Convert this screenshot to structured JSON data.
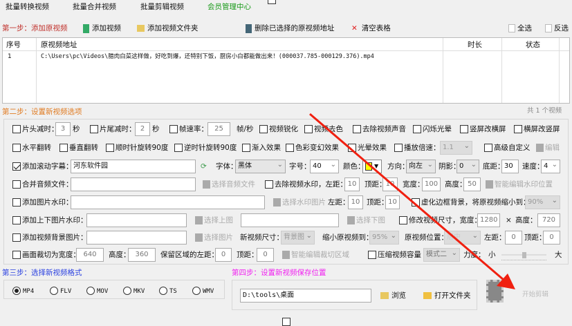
{
  "tabs": [
    "批量转换视频",
    "批量合并视频",
    "批量剪辑视频",
    "会员管理中心"
  ],
  "step1": {
    "title": "第一步：添加原视频",
    "add_video": "添加视频",
    "add_folder": "添加视频文件夹",
    "delete_selected": "删除已选择的原视频地址",
    "clear_table": "清空表格",
    "select_all": "全选",
    "invert": "反选"
  },
  "table": {
    "headers": [
      "序号",
      "原视频地址",
      "时长",
      "状态"
    ],
    "rows": [
      {
        "index": "1",
        "path": "C:\\Users\\pc\\Videos\\腊肉白菜这样做，好吃到爆，还特别下饭，厨房小白都能做出来！(000037.785-000129.376).mp4"
      }
    ]
  },
  "step2": {
    "title": "第二步：设置新视频选项",
    "count": "共 1 个视频",
    "head_trim": "片头减时：",
    "head_val": "3",
    "sec": "秒",
    "tail_trim": "片尾减时：",
    "tail_val": "2",
    "fps": "帧速率：",
    "fps_val": "25",
    "fps_unit": "帧/秒",
    "sharpen": "视频锐化",
    "decolor": "视频去色",
    "mute": "去除视频声音",
    "flash": "闪烁光晕",
    "v2h": "竖屏改横屏",
    "h2v": "横屏改竖屏",
    "hflip": "水平翻转",
    "vflip": "垂直翻转",
    "cw90": "顺时针旋转90度",
    "ccw90": "逆时针旋转90度",
    "fadein": "渐入效果",
    "color_fx": "色彩变幻效果",
    "halo": "光晕效果",
    "speed": "播放倍速：",
    "speed_val": "1.1",
    "advanced": "高级自定义",
    "edit": "编辑",
    "subtitle": "添加滚动字幕：",
    "subtitle_val": "河东软件园",
    "font": "字体：",
    "font_val": "黑体(simhei)",
    "size": "字号：",
    "size_val": "40",
    "color": "颜色：",
    "color_val": "#ffff00",
    "dir": "方向：",
    "dir_val": "向左",
    "shadow": "阴影：",
    "shadow_val": "0",
    "bottom": "底距：",
    "bottom_val": "30",
    "rate": "速度：",
    "rate_val": "4",
    "audio": "合并音频文件：",
    "choose_audio": "选择音频文件",
    "rm_wm": "去除视频水印，左距：",
    "wm_left": "10",
    "top": "顶距：",
    "wm_top": "10",
    "width": "宽度：",
    "wm_w": "100",
    "height": "高度：",
    "wm_h": "50",
    "smart_wm": "智能编辑水印位置",
    "img_wm": "添加图片水印：",
    "choose_wm": "选择水印图片",
    "left": "左距：",
    "img_left": "10",
    "img_top": "10",
    "blur_bg": "虚化边框背景，将原视频缩小到：",
    "blur_val": "90%",
    "tb_wm": "添加上下图片水印：",
    "choose_top": "选择上图",
    "choose_bottom": "选择下图",
    "resize": "修改视频尺寸，宽度：",
    "resize_w": "1280",
    "x": "×",
    "resize_h": "720",
    "bg_img": "添加视频背景图片：",
    "choose_img": "选择图片",
    "new_size": "新视频尺寸：",
    "new_size_val": "背景图",
    "shrink": "缩小原视频到：",
    "shrink_val": "95%",
    "pos": "原视频位置：",
    "pos_val": "居中",
    "bg_left": "0",
    "bg_top": "0",
    "crop": "画面裁切为宽度：",
    "crop_w": "640",
    "crop_h": "360",
    "keep_left": "保留区域的左距：",
    "crop_left": "0",
    "crop_top": "0",
    "smart_crop": "智能编辑裁切区域",
    "compress": "压缩视频容量",
    "mode_val": "模式二",
    "strength": "力度：",
    "small": "小",
    "big": "大",
    "strength_level": 0.5
  },
  "step3": {
    "title": "第三步：选择新视频格式",
    "formats": [
      "MP4",
      "FLV",
      "MOV",
      "MKV",
      "TS",
      "WMV"
    ],
    "selected": "MP4"
  },
  "step4": {
    "title": "第四步：设置新视频保存位置",
    "path": "D:\\tools\\桌面",
    "browse": "浏览",
    "open_folder": "打开文件夹",
    "start": "开始剪辑"
  }
}
